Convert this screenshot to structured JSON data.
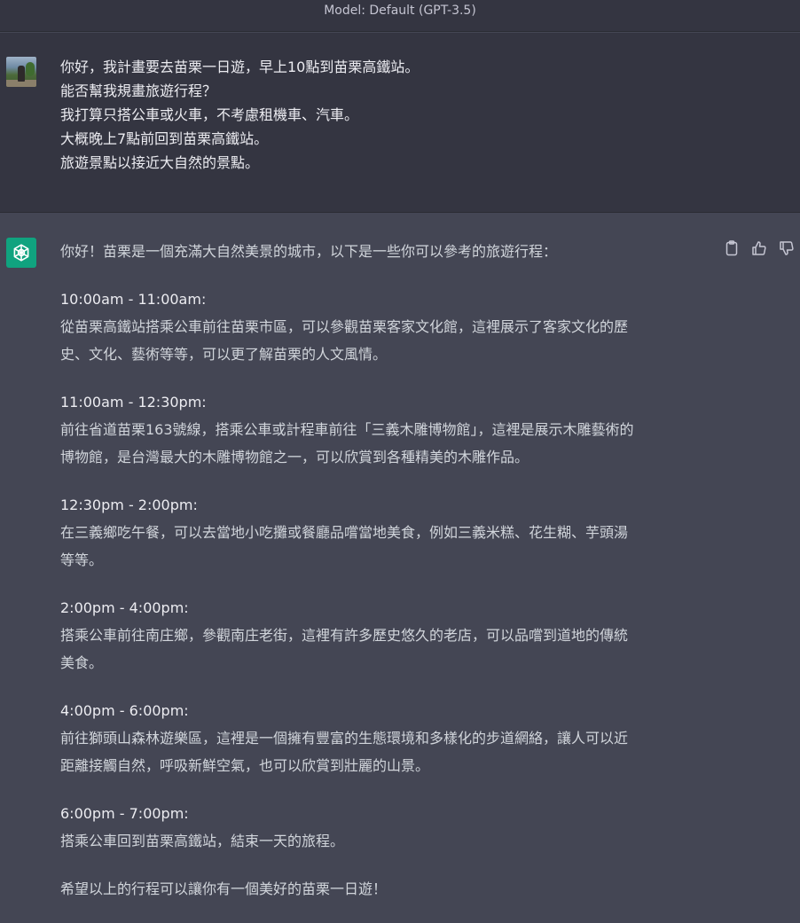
{
  "header": {
    "model_label": "Model: Default (GPT-3.5)"
  },
  "user_message": {
    "lines": [
      "你好，我計畫要去苗栗一日遊，早上10點到苗栗高鐵站。",
      "能否幫我規畫旅遊行程？",
      "我打算只搭公車或火車，不考慮租機車、汽車。",
      "大概晚上7點前回到苗栗高鐵站。",
      "旅遊景點以接近大自然的景點。"
    ]
  },
  "assistant_message": {
    "intro": "你好！苗栗是一個充滿大自然美景的城市，以下是一些你可以參考的旅遊行程：",
    "itinerary": [
      {
        "time": "10:00am - 11:00am:",
        "desc_lines": [
          "從苗栗高鐵站搭乘公車前往苗栗市區，可以參觀苗栗客家文化館，這裡展示了客家文化的歷",
          "史、文化、藝術等等，可以更了解苗栗的人文風情。"
        ]
      },
      {
        "time": "11:00am - 12:30pm:",
        "desc_lines": [
          "前往省道苗栗163號線，搭乘公車或計程車前往「三義木雕博物館」，這裡是展示木雕藝術的",
          "博物館，是台灣最大的木雕博物館之一，可以欣賞到各種精美的木雕作品。"
        ]
      },
      {
        "time": "12:30pm - 2:00pm:",
        "desc_lines": [
          "在三義鄉吃午餐，可以去當地小吃攤或餐廳品嚐當地美食，例如三義米糕、花生糊、芋頭湯",
          "等等。"
        ]
      },
      {
        "time": "2:00pm - 4:00pm:",
        "desc_lines": [
          "搭乘公車前往南庄鄉，參觀南庄老街，這裡有許多歷史悠久的老店，可以品嚐到道地的傳統",
          "美食。"
        ]
      },
      {
        "time": "4:00pm - 6:00pm:",
        "desc_lines": [
          "前往獅頭山森林遊樂區，這裡是一個擁有豐富的生態環境和多樣化的步道網絡，讓人可以近",
          "距離接觸自然，呼吸新鮮空氣，也可以欣賞到壯麗的山景。"
        ]
      },
      {
        "time": "6:00pm - 7:00pm:",
        "desc_lines": [
          "搭乘公車回到苗栗高鐵站，結束一天的旅程。"
        ]
      }
    ],
    "closing": "希望以上的行程可以讓你有一個美好的苗栗一日遊！"
  },
  "icons": {
    "copy": "clipboard-icon",
    "like": "thumbs-up-icon",
    "dislike": "thumbs-down-icon",
    "assistant_avatar": "openai-logo-icon"
  },
  "colors": {
    "assistant_bg": "#444654",
    "user_bg": "#343541",
    "brand_green": "#10a37f"
  }
}
